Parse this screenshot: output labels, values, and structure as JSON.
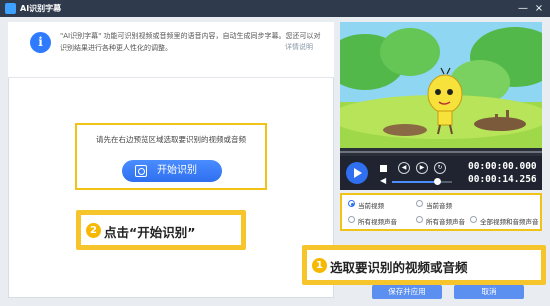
{
  "window": {
    "title": "AI识别字幕",
    "controls": {
      "minimize": "—",
      "close": "×"
    }
  },
  "info": {
    "icon": "info-icon",
    "icon_glyph": "i",
    "text": "\"AI识别字幕\" 功能可识别视频或音频里的语音内容，自动生成同步字幕。",
    "text_line2": "识别结果进行各种更人性化的调整。",
    "text_right": "您还可以对",
    "link": "详情说明"
  },
  "main": {
    "hint": "请先在右边预览区域选取要识别的视频或音频",
    "start_button": "开始识别"
  },
  "callouts": {
    "step2": {
      "number": "2",
      "text": "点击“开始识别”"
    },
    "step1": {
      "number": "1",
      "text": "选取要识别的视频或音频"
    }
  },
  "player": {
    "time_current": "00:00:00.000",
    "time_total": "00:00:14.256",
    "volume": 0.75
  },
  "options": {
    "items": [
      {
        "label": "当前视频",
        "selected": true
      },
      {
        "label": "当前音频",
        "selected": false
      },
      {
        "label": "所有视频声音",
        "selected": false
      },
      {
        "label": "所有音频声音",
        "selected": false
      },
      {
        "label": "全部视频和音频声音",
        "selected": false
      }
    ]
  },
  "footer": {
    "save_label": "保存并应用",
    "cancel_label": "取消"
  },
  "colors": {
    "accent": "#2f6ff0",
    "highlight": "#f2c317",
    "titlebar": "#2f3a4c"
  }
}
